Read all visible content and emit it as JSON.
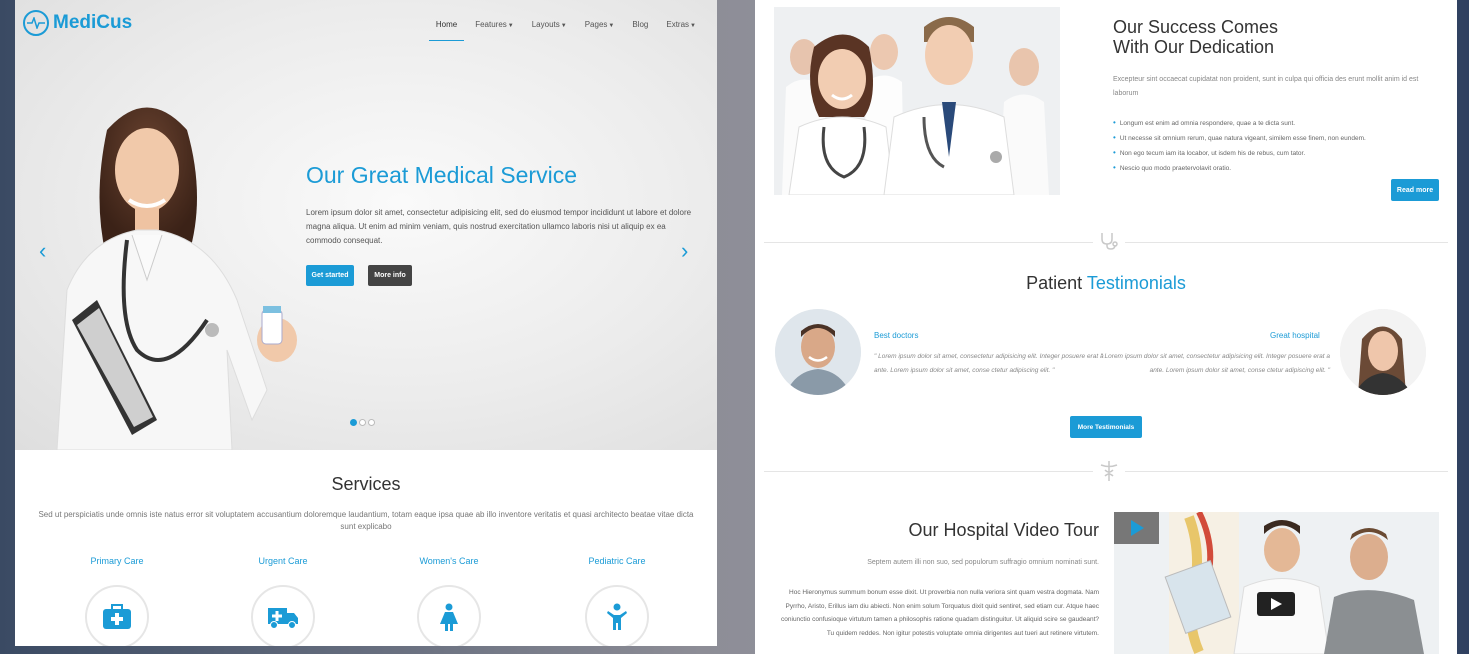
{
  "brand": {
    "name": "MediCus"
  },
  "nav": {
    "items": [
      {
        "label": "Home",
        "active": true,
        "dropdown": false
      },
      {
        "label": "Features",
        "active": false,
        "dropdown": true
      },
      {
        "label": "Layouts",
        "active": false,
        "dropdown": true
      },
      {
        "label": "Pages",
        "active": false,
        "dropdown": true
      },
      {
        "label": "Blog",
        "active": false,
        "dropdown": false
      },
      {
        "label": "Extras",
        "active": false,
        "dropdown": true
      }
    ]
  },
  "hero": {
    "title": "Our Great Medical Service",
    "text": "Lorem ipsum dolor sit amet, consectetur adipisicing elit, sed do eiusmod tempor incididunt ut labore et dolore magna aliqua. Ut enim ad minim veniam, quis nostrud exercitation ullamco laboris nisi ut aliquip ex ea commodo consequat.",
    "primary_button": "Get started",
    "secondary_button": "More info",
    "slides_total": 3,
    "active_slide": 1
  },
  "services": {
    "title": "Services",
    "text": "Sed ut perspiciatis unde omnis iste natus error sit voluptatem accusantium doloremque laudantium, totam eaque ipsa quae ab illo inventore veritatis et quasi architecto beatae vitae dicta sunt explicabo",
    "items": [
      {
        "label": "Primary Care",
        "icon": "medical-kit-icon"
      },
      {
        "label": "Urgent Care",
        "icon": "ambulance-icon"
      },
      {
        "label": "Women's Care",
        "icon": "woman-icon"
      },
      {
        "label": "Pediatric Care",
        "icon": "child-icon"
      }
    ]
  },
  "success": {
    "title_line1": "Our Success Comes",
    "title_line2": "With Our Dedication",
    "text": "Excepteur sint occaecat cupidatat non proident, sunt in culpa qui officia des erunt mollit anim id est laborum",
    "bullets": [
      "Longum est enim ad omnia respondere, quae a te dicta sunt.",
      "Ut necesse sit omnium rerum, quae natura vigeant, similem esse finem, non eundem.",
      "Non ego tecum iam ita locabor, ut isdem his de rebus, cum tator.",
      "Nescio quo modo praetervolavit oratio."
    ],
    "button": "Read more"
  },
  "testimonials": {
    "title_plain": "Patient",
    "title_highlight": "Testimonials",
    "items": [
      {
        "name": "Best doctors",
        "quote": "\" Lorem ipsum dolor sit amet, consectetur adipisicing elit. Integer posuere erat a ante. Lorem ipsum dolor sit amet, conse ctetur adipiscing elit. \""
      },
      {
        "name": "Great hospital",
        "quote": "\" Lorem ipsum dolor sit amet, consectetur adipisicing elit. Integer posuere erat a ante. Lorem ipsum dolor sit amet, conse ctetur adipiscing elit. \""
      }
    ],
    "button": "More Testimonials"
  },
  "video_tour": {
    "title": "Our Hospital Video Tour",
    "subtitle": "Septem autem illi non suo, sed populorum suffragio omnium nominati sunt.",
    "text": "Hoc Hieronymus summum bonum esse dixit. Ut proverbia non nulla veriora sint quam vestra dogmata. Nam Pyrrho, Aristo, Erillus iam diu abiecti. Non enim solum Torquatus dixit quid sentiret, sed etiam cur. Atque haec coniunctio confusioque virtutum tamen a philosophis ratione quadam distinguitur. Ut aliquid scire se gaudeant? Tu quidem reddes. Non igitur potestis voluptate omnia dirigentes aut tueri aut retinere virtutem."
  },
  "colors": {
    "accent": "#1b9bd6",
    "dark_button": "#444444",
    "text": "#333333"
  }
}
